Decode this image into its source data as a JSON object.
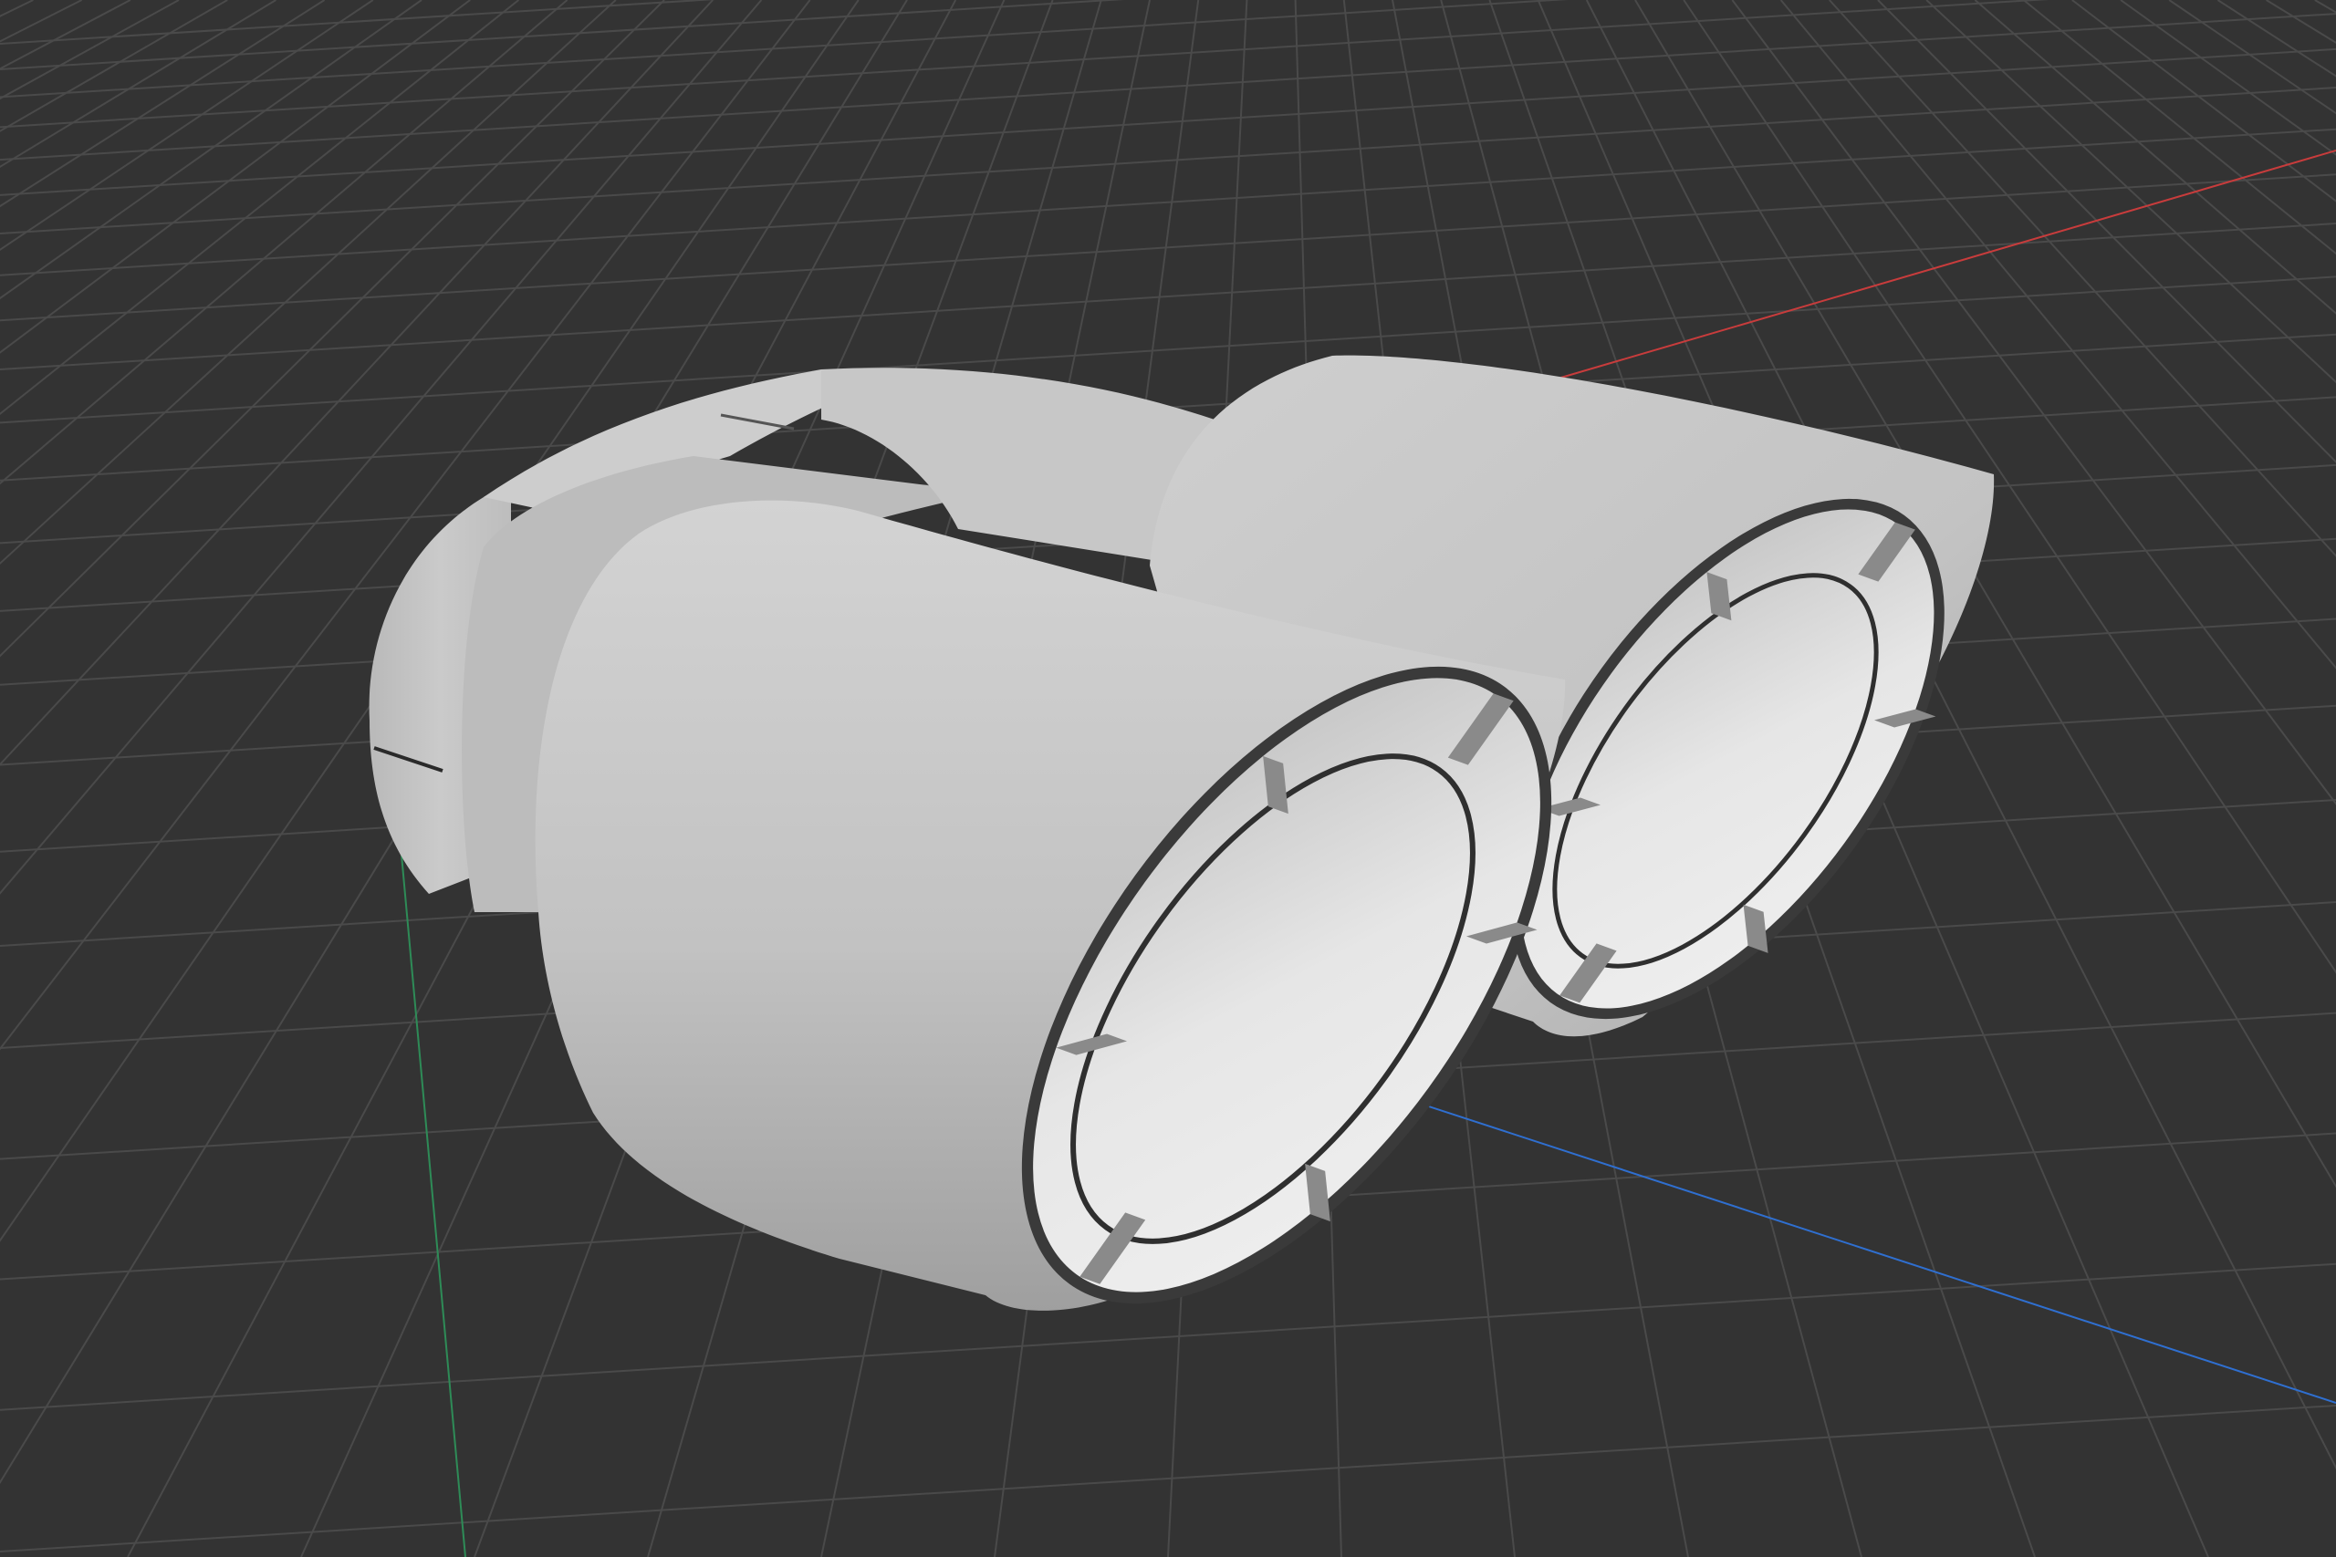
{
  "viewport": {
    "background": "#333333",
    "grid_color": "#4a4a4a",
    "grid_major_color": "#555555",
    "axis_x_color": "#c83c3c",
    "axis_y_color": "#2e8b57",
    "axis_z_color": "#2f6fd0"
  },
  "model": {
    "name": "twin-exhaust-tip",
    "body_color": "#c4c4c4",
    "highlight_color": "#d6d6d6",
    "shadow_color": "#9c9c9c",
    "rim_color": "#3a3a3a",
    "inner_color": "#e2e2e2",
    "tip_count": 2,
    "vane_count": 6
  }
}
